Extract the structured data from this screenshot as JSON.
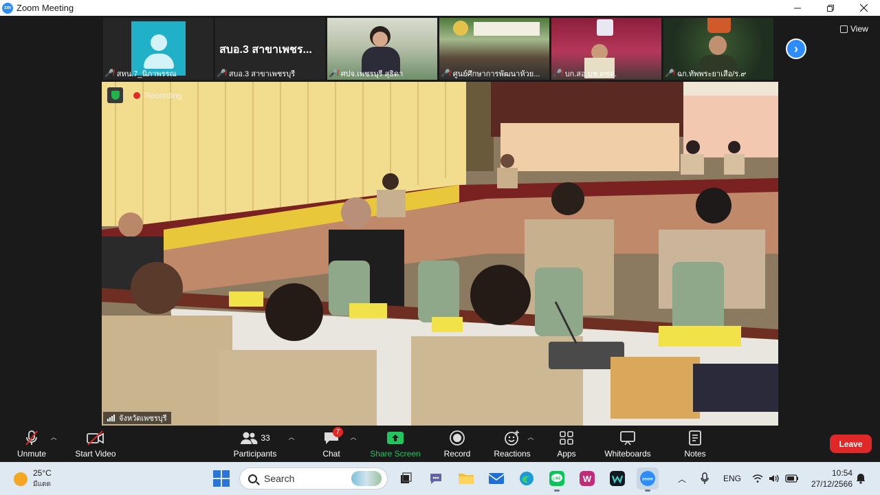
{
  "window": {
    "title": "Zoom Meeting",
    "app_icon": "zm",
    "controls": [
      "minimize-icon",
      "restore-icon",
      "close-icon"
    ]
  },
  "view_button": {
    "label": "View"
  },
  "participants_strip": [
    {
      "name": "สหน.7_นิภาพรรณ",
      "muted": true,
      "video": false
    },
    {
      "name": "สบอ.3 สาขาเพชรบุรี",
      "display_text": "สบอ.3 สาขาเพชร...",
      "muted": true,
      "video": false
    },
    {
      "name": "ศปจ.เพชรบุรี สุธิดา",
      "muted": true,
      "video": true
    },
    {
      "name": "ศูนย์ศึกษาการพัฒนาห้วย...",
      "muted": true,
      "video": true
    },
    {
      "name": "บก.สอ.บช.ตชด.",
      "muted": true,
      "video": true
    },
    {
      "name": "ฉก.ทัพพระยาเสือ/ร.๙",
      "muted": true,
      "video": true
    }
  ],
  "active_speaker": {
    "name": "จังหวัดเพชรบุรี",
    "recording_label": "Recording"
  },
  "toolbar": {
    "unmute": "Unmute",
    "start_video": "Start Video",
    "participants": "Participants",
    "participants_count": "33",
    "chat": "Chat",
    "chat_badge": "7",
    "share_screen": "Share Screen",
    "record": "Record",
    "reactions": "Reactions",
    "apps": "Apps",
    "whiteboards": "Whiteboards",
    "notes": "Notes",
    "leave": "Leave"
  },
  "taskbar": {
    "weather_temp": "25°C",
    "weather_desc": "มีแดด",
    "search_placeholder": "Search",
    "language": "ENG",
    "time": "10:54",
    "date": "27/12/2566",
    "apps": [
      "start-icon",
      "file-explorer-icon",
      "teams-chat-icon",
      "folder-icon",
      "mail-icon",
      "edge-icon",
      "line-icon",
      "app-w-icon",
      "webex-icon",
      "zoom-icon"
    ]
  },
  "colors": {
    "zoom_blue": "#2d8cff",
    "share_green": "#22c55e",
    "leave_red": "#e02828",
    "meeting_bg": "#1a1a1a"
  }
}
